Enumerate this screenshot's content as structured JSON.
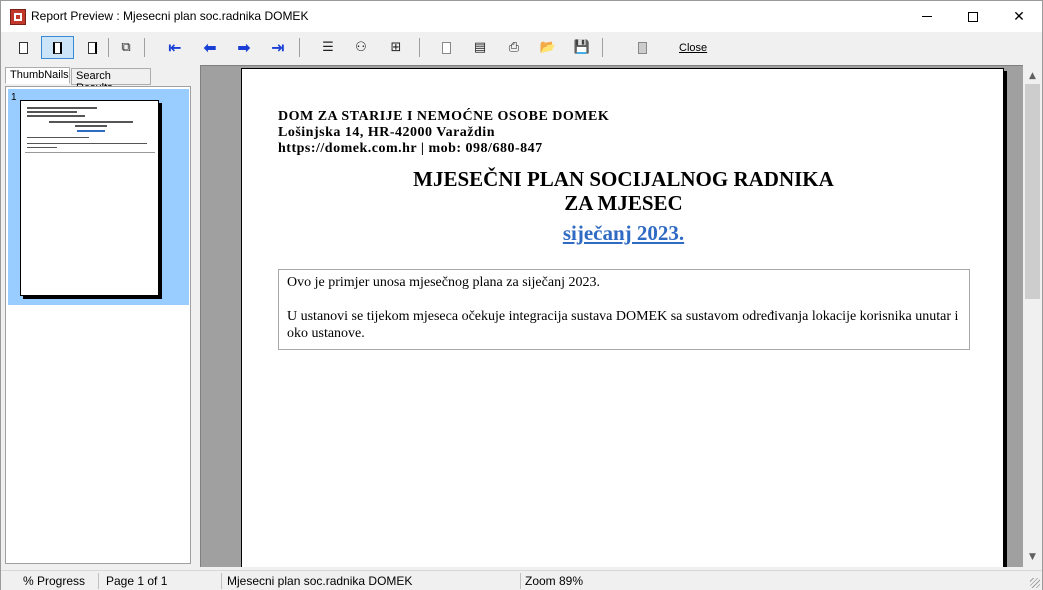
{
  "window": {
    "title": "Report Preview : Mjesecni plan soc.radnika DOMEK"
  },
  "toolbar": {
    "close_label": "Close"
  },
  "tabs": [
    {
      "label": "ThumbNails",
      "active": true
    },
    {
      "label": "Search Results",
      "active": false
    }
  ],
  "thumbnails": [
    {
      "number": "1",
      "selected": true
    }
  ],
  "report": {
    "org_name": "DOM ZA STARIJE I NEMOĆNE OSOBE DOMEK",
    "org_address": "Lošinjska 14, HR-42000 Varaždin",
    "org_contact": "https://domek.com.hr | mob: 098/680-847",
    "title_line1": "MJESEČNI PLAN SOCIJALNOG RADNIKA",
    "title_line2": "ZA MJESEC",
    "month": "siječanj 2023.",
    "paragraph1": "Ovo je primjer unosa mjesečnog plana za siječanj 2023.",
    "paragraph2": "U ustanovi se tijekom mjeseca očekuje integracija sustava DOMEK sa sustavom određivanja lokacije korisnika unutar i oko ustanove."
  },
  "status": {
    "progress": "% Progress",
    "page": "Page 1 of 1",
    "report_name": "Mjesecni plan soc.radnika DOMEK",
    "zoom": "Zoom 89%"
  },
  "colors": {
    "accent_blue": "#2f6ac3",
    "nav_arrow": "#1a3fd6",
    "selection": "#99ccff"
  }
}
